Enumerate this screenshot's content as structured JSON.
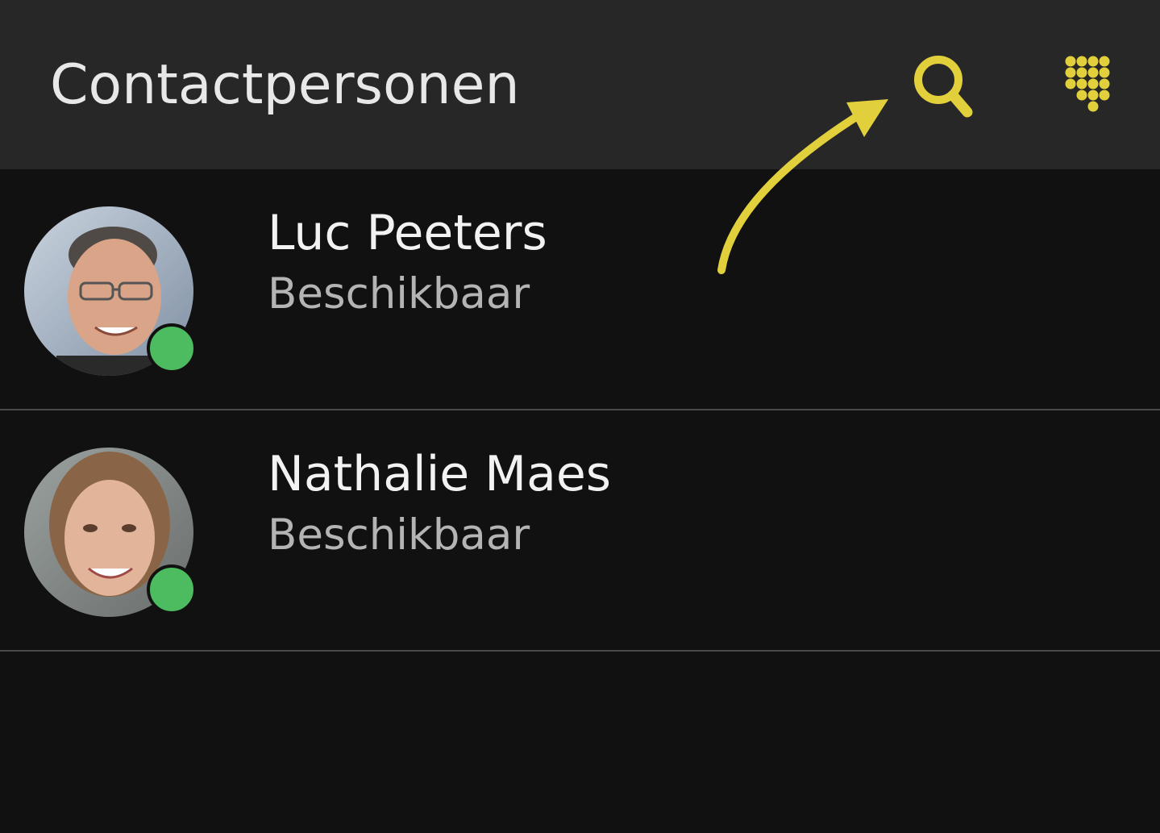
{
  "appbar": {
    "title": "Contactpersonen",
    "search_icon": "search-icon",
    "dialpad_icon": "dialpad-icon",
    "accent_color": "#e2cf3c"
  },
  "contacts": [
    {
      "name": "Luc Peeters",
      "status": "Beschikbaar",
      "presence_color": "#4dbb5f"
    },
    {
      "name": "Nathalie Maes",
      "status": "Beschikbaar",
      "presence_color": "#4dbb5f"
    }
  ],
  "annotation": {
    "arrow_icon": "curved-arrow-icon",
    "arrow_color": "#e2cf3c"
  }
}
